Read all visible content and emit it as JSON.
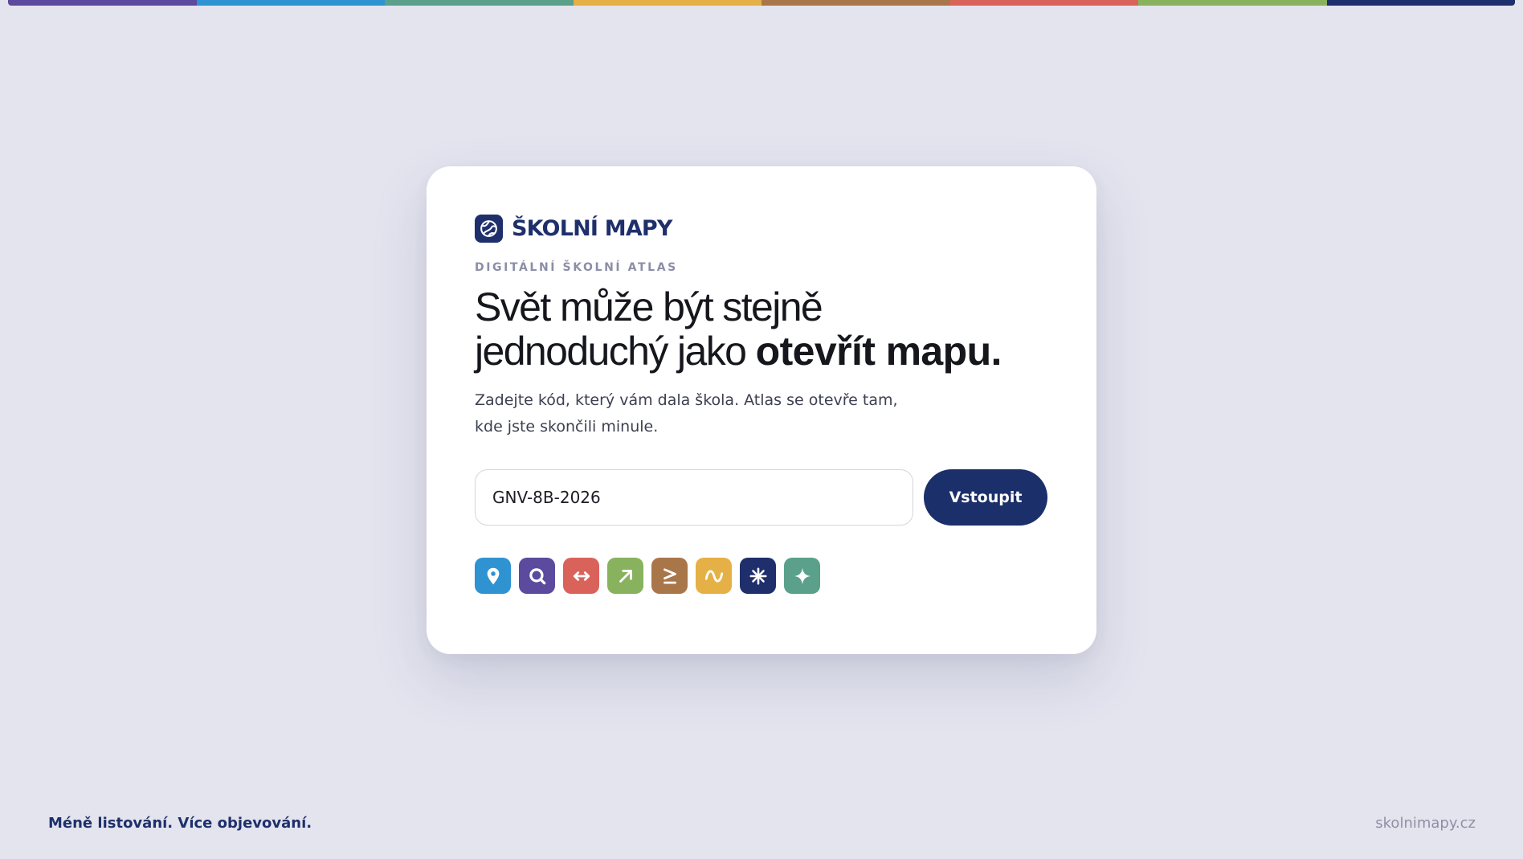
{
  "colors": {
    "background": "#e3e4ee",
    "card": "#ffffff",
    "brand": "#1e2f6b",
    "button": "#1b2f6a",
    "top_bar": [
      "#5b4a9e",
      "#2f93d1",
      "#5aa08a",
      "#e5b046",
      "#a9764a",
      "#d9625b",
      "#88b25d",
      "#1e2f6b"
    ]
  },
  "brand": {
    "logo_icon": "globe-icon",
    "name": "ŠKOLNÍ MAPY"
  },
  "hero": {
    "eyebrow": "DIGITÁLNÍ ŠKOLNÍ ATLAS",
    "headline_line1": "Svět může být stejně",
    "headline_line2_regular": "jednoduchý jako ",
    "headline_line2_bold": "otevřít mapu.",
    "description": "Zadejte kód, který vám dala škola. Atlas se otevře tam, kde jste skončili minule."
  },
  "form": {
    "code_value": "GNV-8B-2026",
    "submit_label": "Vstoupit"
  },
  "tools": [
    {
      "icon": "location-pin-icon",
      "color": "#2f93d1"
    },
    {
      "icon": "search-icon",
      "color": "#5b4a9e"
    },
    {
      "icon": "measure-distance-icon",
      "color": "#d9625b"
    },
    {
      "icon": "arrow-up-right-icon",
      "color": "#88b25d"
    },
    {
      "icon": "greater-equal-icon",
      "color": "#a9764a"
    },
    {
      "icon": "wave-icon",
      "color": "#e5b046"
    },
    {
      "icon": "asterisk-icon",
      "color": "#1e2f6b"
    },
    {
      "icon": "sparkle-icon",
      "color": "#5aa08a"
    }
  ],
  "footer": {
    "tagline": "Méně listování. Více objevování.",
    "domain": "skolnimapy.cz"
  }
}
